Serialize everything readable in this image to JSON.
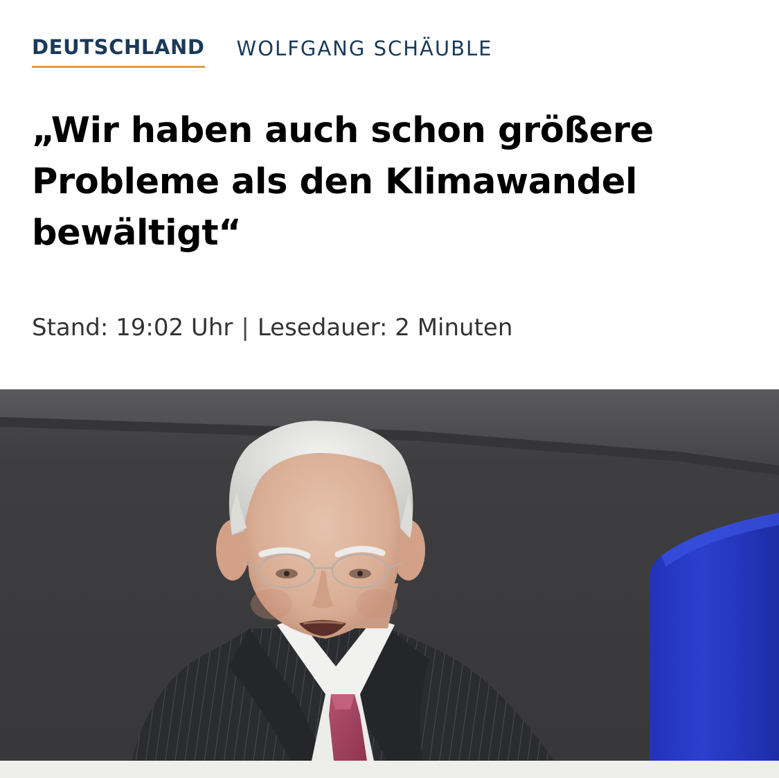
{
  "nav": {
    "section": "DEUTSCHLAND",
    "topic": "WOLFGANG SCHÄUBLE"
  },
  "article": {
    "headline_line1": "„Wir haben auch schon größere",
    "headline_line2": "Probleme als den Klimawandel",
    "headline_line3": "bewältigt“",
    "stand": "Stand: 19:02 Uhr",
    "separator": "|",
    "lesedauer": "Lesedauer: 2 Minuten"
  },
  "colors": {
    "accent_underline": "#e39a48",
    "nav_text": "#1b3a5a",
    "headline_text": "#000000",
    "seat_blue": "#2b3fcf"
  }
}
